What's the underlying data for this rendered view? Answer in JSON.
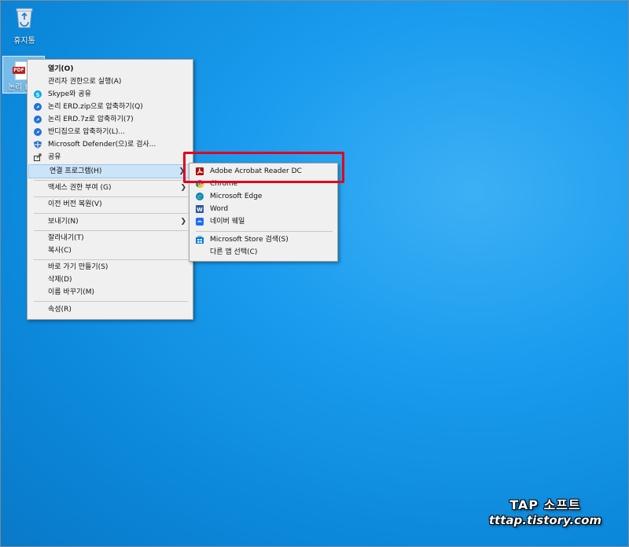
{
  "desktop": {
    "recycle_label": "휴지통",
    "pdf_icon_tag": "PDF",
    "pdf_label": "논리 E"
  },
  "menu": {
    "items": [
      {
        "label": "열기(O)",
        "icon": "none",
        "bold": true
      },
      {
        "label": "관리자 권한으로 실행(A)",
        "icon": "none"
      },
      {
        "label": "Skype와 공유",
        "icon": "skype-icon"
      },
      {
        "label": "논리 ERD.zip으로 압축하기(Q)",
        "icon": "bandizip-icon"
      },
      {
        "label": "논리 ERD.7z로 압축하기(7)",
        "icon": "bandizip-icon"
      },
      {
        "label": "반디집으로 압축하기(L)...",
        "icon": "bandizip-icon"
      },
      {
        "label": "Microsoft Defender(으)로 검사...",
        "icon": "defender-icon"
      },
      {
        "label": "공유",
        "icon": "share-icon"
      },
      {
        "label": "연결 프로그램(H)",
        "icon": "none"
      },
      {
        "label": "액세스 권한 부여 (G)",
        "icon": "none"
      },
      {
        "label": "이전 버전 복원(V)",
        "icon": "none"
      },
      {
        "label": "보내기(N)",
        "icon": "none"
      },
      {
        "label": "잘라내기(T)",
        "icon": "none"
      },
      {
        "label": "복사(C)",
        "icon": "none"
      },
      {
        "label": "바로 가기 만들기(S)",
        "icon": "none"
      },
      {
        "label": "삭제(D)",
        "icon": "none"
      },
      {
        "label": "이름 바꾸기(M)",
        "icon": "none"
      },
      {
        "label": "속성(R)",
        "icon": "none"
      }
    ]
  },
  "submenu": {
    "items": [
      {
        "label": "Adobe Acrobat Reader DC",
        "icon": "acrobat-icon"
      },
      {
        "label": "Chrome",
        "icon": "chrome-icon"
      },
      {
        "label": "Microsoft Edge",
        "icon": "edge-icon"
      },
      {
        "label": "Word",
        "icon": "word-icon"
      },
      {
        "label": "네이버 웨일",
        "icon": "whale-icon"
      },
      {
        "label": "Microsoft Store 검색(S)",
        "icon": "store-icon"
      },
      {
        "label": "다른 앱 선택(C)",
        "icon": "none"
      }
    ]
  },
  "watermark": {
    "line1": "TAP 소프트",
    "line2": "tttap.tistory.com"
  },
  "colors": {
    "desktop": "#0b86d8",
    "highlight_box": "#e3001b",
    "hover": "#cce4f7"
  }
}
